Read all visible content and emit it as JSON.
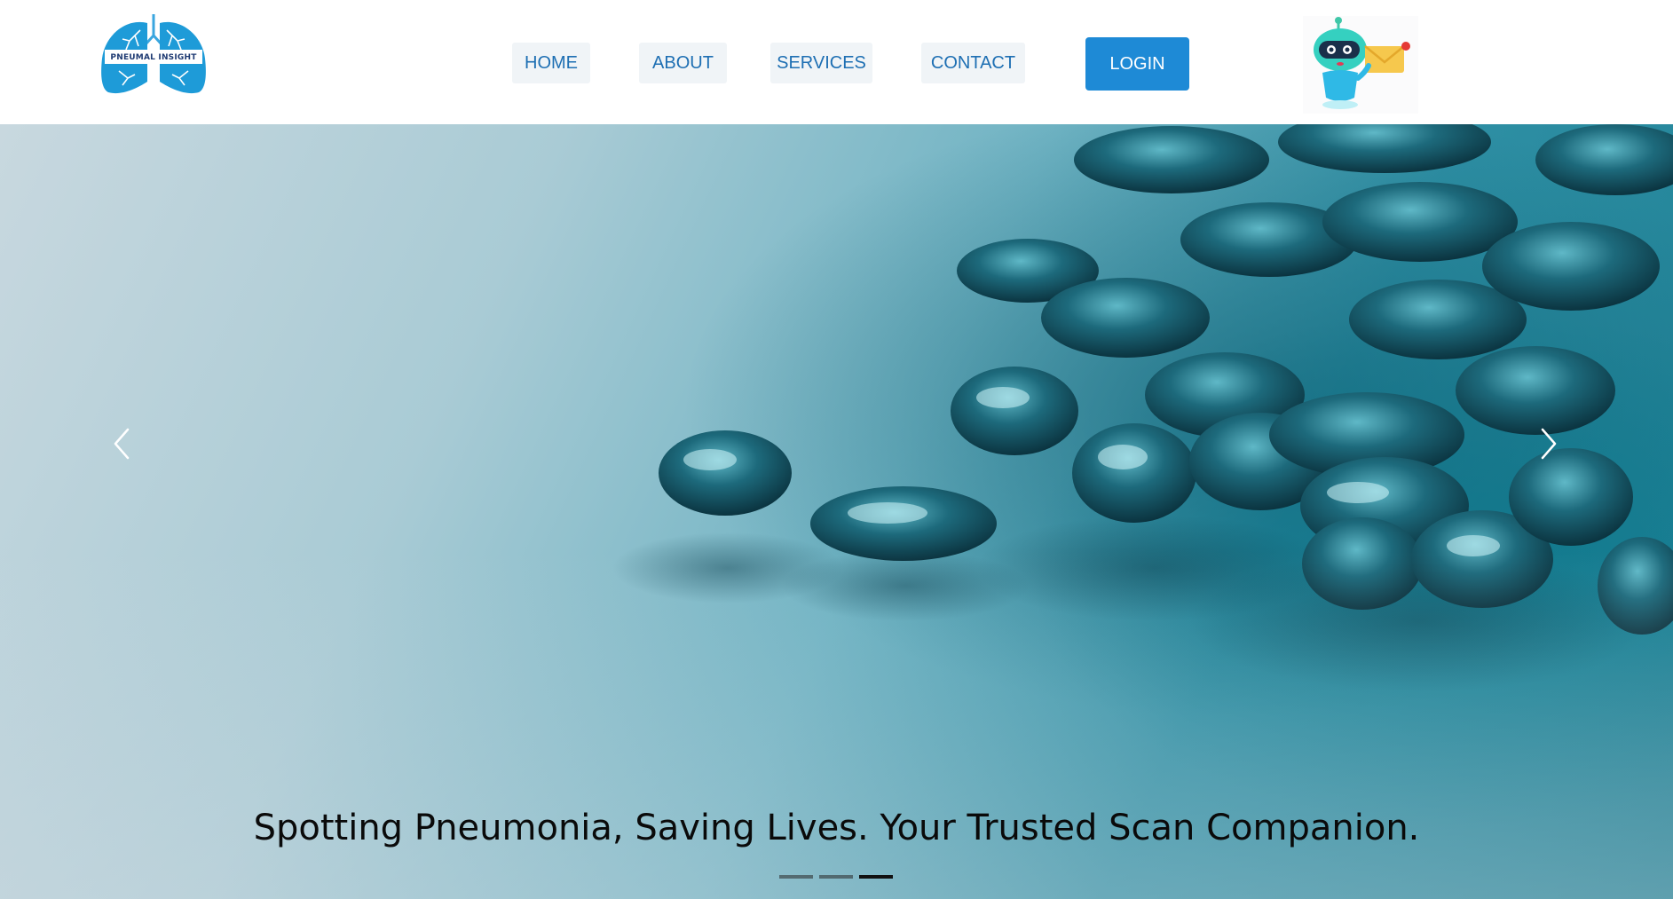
{
  "brand": {
    "logo_text": "PNEUMAL INSIGHT",
    "logo_color": "#1f9bd7"
  },
  "nav": {
    "items": [
      {
        "label": "HOME"
      },
      {
        "label": "ABOUT"
      },
      {
        "label": "SERVICES"
      },
      {
        "label": "CONTACT"
      }
    ],
    "login_label": "LOGIN",
    "accent": "#1e8ad6",
    "chatbot_icon": "robot-chatbot-icon"
  },
  "hero": {
    "caption": "Spotting Pneumonia, Saving Lives. Your Trusted Scan Companion.",
    "slide_count": 3,
    "active_slide": 3,
    "prev_icon": "chevron-left-icon",
    "next_icon": "chevron-right-icon",
    "image": "teal-capsules-photo"
  }
}
